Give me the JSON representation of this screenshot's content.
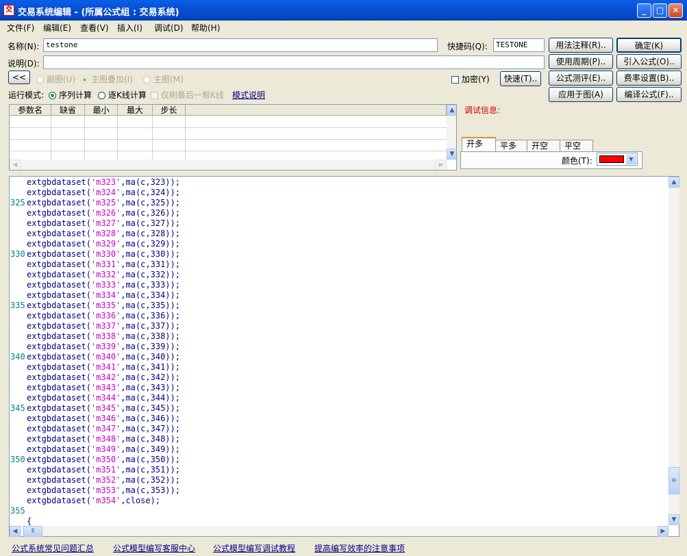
{
  "window": {
    "title": "交易系统编辑 - (所属公式组 : 交易系统)",
    "icon_text": "交"
  },
  "menu": [
    "文件(F)",
    "编辑(E)",
    "查看(V)",
    "插入(I)",
    "调试(D)",
    "帮助(H)"
  ],
  "form": {
    "name_label": "名称(N):",
    "name_value": "testone",
    "shortcut_label": "快捷码(Q):",
    "shortcut_value": "TESTONE",
    "desc_label": "说明(D):",
    "desc_value": "",
    "collapse_button": "<<",
    "chart_radios": [
      "副图(U)",
      "主图叠加(I)",
      "主图(M)"
    ],
    "encrypt_label": "加密(Y)",
    "fast_button": "快速(T)..",
    "run_mode_label": "运行模式:",
    "run_modes": [
      "序列计算",
      "逐K线计算"
    ],
    "last_bar_only": "仅刷最后一根K线",
    "mode_help_link": "模式说明"
  },
  "right_buttons": [
    [
      "用法注释(R)..",
      "确定(K)"
    ],
    [
      "使用周期(P)..",
      "引入公式(O).."
    ],
    [
      "公式测评(E)..",
      "费率设置(B).."
    ],
    [
      "应用于图(A)",
      "编译公式(F).."
    ]
  ],
  "param_table": {
    "columns": [
      "参数名",
      "缺省",
      "最小",
      "最大",
      "步长"
    ]
  },
  "debug": {
    "label": "调试信息:",
    "tabs": [
      "开多",
      "平多",
      "开空",
      "平空"
    ],
    "color_label": "颜色(T):",
    "color_value": "#FF0000"
  },
  "code_lines": [
    {
      "n": "",
      "pre": "extgbdataset(",
      "s": "'m323'",
      "post": ",ma(c,323));"
    },
    {
      "n": "",
      "pre": "extgbdataset(",
      "s": "'m324'",
      "post": ",ma(c,324));"
    },
    {
      "n": "325",
      "pre": "extgbdataset(",
      "s": "'m325'",
      "post": ",ma(c,325));"
    },
    {
      "n": "",
      "pre": "extgbdataset(",
      "s": "'m326'",
      "post": ",ma(c,326));"
    },
    {
      "n": "",
      "pre": "extgbdataset(",
      "s": "'m327'",
      "post": ",ma(c,327));"
    },
    {
      "n": "",
      "pre": "extgbdataset(",
      "s": "'m328'",
      "post": ",ma(c,328));"
    },
    {
      "n": "",
      "pre": "extgbdataset(",
      "s": "'m329'",
      "post": ",ma(c,329));"
    },
    {
      "n": "330",
      "pre": "extgbdataset(",
      "s": "'m330'",
      "post": ",ma(c,330));"
    },
    {
      "n": "",
      "pre": "extgbdataset(",
      "s": "'m331'",
      "post": ",ma(c,331));"
    },
    {
      "n": "",
      "pre": "extgbdataset(",
      "s": "'m332'",
      "post": ",ma(c,332));"
    },
    {
      "n": "",
      "pre": "extgbdataset(",
      "s": "'m333'",
      "post": ",ma(c,333));"
    },
    {
      "n": "",
      "pre": "extgbdataset(",
      "s": "'m334'",
      "post": ",ma(c,334));"
    },
    {
      "n": "335",
      "pre": "extgbdataset(",
      "s": "'m335'",
      "post": ",ma(c,335));"
    },
    {
      "n": "",
      "pre": "extgbdataset(",
      "s": "'m336'",
      "post": ",ma(c,336));"
    },
    {
      "n": "",
      "pre": "extgbdataset(",
      "s": "'m337'",
      "post": ",ma(c,337));"
    },
    {
      "n": "",
      "pre": "extgbdataset(",
      "s": "'m338'",
      "post": ",ma(c,338));"
    },
    {
      "n": "",
      "pre": "extgbdataset(",
      "s": "'m339'",
      "post": ",ma(c,339));"
    },
    {
      "n": "340",
      "pre": "extgbdataset(",
      "s": "'m340'",
      "post": ",ma(c,340));"
    },
    {
      "n": "",
      "pre": "extgbdataset(",
      "s": "'m341'",
      "post": ",ma(c,341));"
    },
    {
      "n": "",
      "pre": "extgbdataset(",
      "s": "'m342'",
      "post": ",ma(c,342));"
    },
    {
      "n": "",
      "pre": "extgbdataset(",
      "s": "'m343'",
      "post": ",ma(c,343));"
    },
    {
      "n": "",
      "pre": "extgbdataset(",
      "s": "'m344'",
      "post": ",ma(c,344));"
    },
    {
      "n": "345",
      "pre": "extgbdataset(",
      "s": "'m345'",
      "post": ",ma(c,345));"
    },
    {
      "n": "",
      "pre": "extgbdataset(",
      "s": "'m346'",
      "post": ",ma(c,346));"
    },
    {
      "n": "",
      "pre": "extgbdataset(",
      "s": "'m347'",
      "post": ",ma(c,347));"
    },
    {
      "n": "",
      "pre": "extgbdataset(",
      "s": "'m348'",
      "post": ",ma(c,348));"
    },
    {
      "n": "",
      "pre": "extgbdataset(",
      "s": "'m349'",
      "post": ",ma(c,349));"
    },
    {
      "n": "350",
      "pre": "extgbdataset(",
      "s": "'m350'",
      "post": ",ma(c,350));"
    },
    {
      "n": "",
      "pre": "extgbdataset(",
      "s": "'m351'",
      "post": ",ma(c,351));"
    },
    {
      "n": "",
      "pre": "extgbdataset(",
      "s": "'m352'",
      "post": ",ma(c,352));"
    },
    {
      "n": "",
      "pre": "extgbdataset(",
      "s": "'m353'",
      "post": ",ma(c,353));"
    },
    {
      "n": "",
      "pre": "extgbdataset(",
      "s": "'m354'",
      "post": ",close);"
    },
    {
      "n": "355",
      "pre": "",
      "s": "",
      "post": ""
    },
    {
      "n": "",
      "pre": "{",
      "s": "",
      "post": ""
    }
  ],
  "footer_links": [
    "公式系统常见问题汇总",
    "公式模型编写客服中心",
    "公式模型编写调试教程",
    "提高编写效率的注意事项"
  ]
}
